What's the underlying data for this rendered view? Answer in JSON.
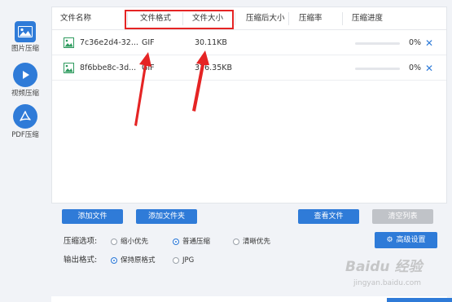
{
  "sidebar": {
    "items": [
      {
        "label": "图片压缩",
        "icon": "image-icon",
        "color": "#2f7bd8"
      },
      {
        "label": "视频压缩",
        "icon": "play-icon",
        "color": "#2f7bd8"
      },
      {
        "label": "PDF压缩",
        "icon": "pdf-icon",
        "color": "#2f7bd8"
      }
    ]
  },
  "table": {
    "headers": [
      "文件名称",
      "文件格式",
      "文件大小",
      "压缩后大小",
      "压缩率",
      "压缩进度"
    ],
    "rows": [
      {
        "name": "7c36e2d4-32...",
        "format": "GIF",
        "size": "30.11KB",
        "progress": "0%",
        "progress_value": 0
      },
      {
        "name": "8f6bbe8c-3d...",
        "format": "GIF",
        "size": "376.35KB",
        "progress": "0%",
        "progress_value": 0
      }
    ]
  },
  "buttons": {
    "add_file": "添加文件",
    "add_folder": "添加文件夹",
    "view_file": "查看文件",
    "clear_list": "清空列表",
    "advanced": "高级设置"
  },
  "options": {
    "compress_label": "压缩选项:",
    "compress_options": [
      "缩小优先",
      "普通压缩",
      "清晰优先"
    ],
    "compress_selected": "普通压缩",
    "format_label": "输出格式:",
    "format_options": [
      "保持原格式",
      "JPG"
    ],
    "format_selected": "保持原格式"
  },
  "watermark": {
    "text": "Baidu 经验",
    "url": "jingyan.baidu.com"
  },
  "colors": {
    "accent": "#2f7bd8",
    "highlight": "#e52424",
    "arrow": "#e52424"
  }
}
